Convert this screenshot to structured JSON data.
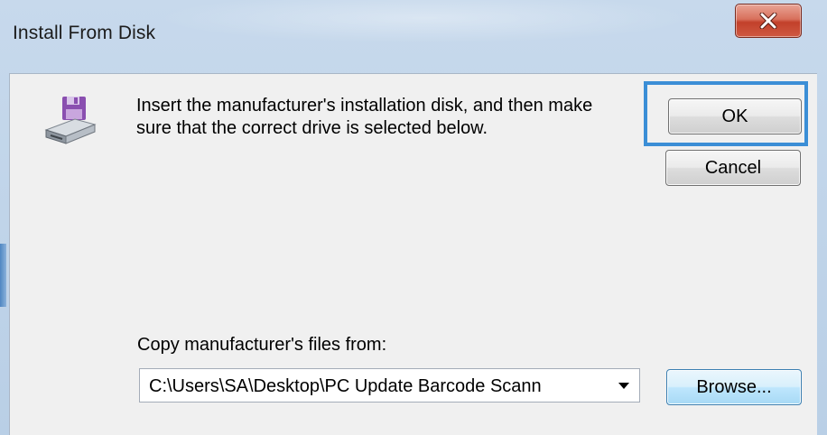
{
  "window": {
    "title": "Install From Disk",
    "close_icon": "close-icon"
  },
  "dialog": {
    "icon": "floppy-disk-drive-icon",
    "instructions": "Insert the manufacturer's installation disk, and then make sure that the correct drive is selected below.",
    "ok_label": "OK",
    "cancel_label": "Cancel",
    "copy_label": "Copy manufacturer's files from:",
    "path_value": "C:\\Users\\SA\\Desktop\\PC Update Barcode Scann",
    "dropdown_icon": "chevron-down-icon",
    "browse_label": "Browse..."
  },
  "colors": {
    "focus_ring": "#3b8ed6",
    "close_button": "#c2402a",
    "client_bg": "#f0f0f0"
  }
}
